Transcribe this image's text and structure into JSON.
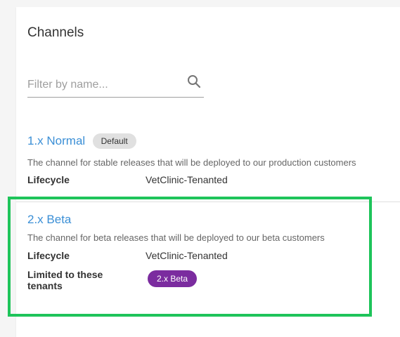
{
  "page": {
    "title": "Channels"
  },
  "filter": {
    "placeholder": "Filter by name...",
    "value": ""
  },
  "channels": [
    {
      "name": "1.x Normal",
      "badge": "Default",
      "description": "The channel for stable releases that will be deployed to our production customers",
      "lifecycle_label": "Lifecycle",
      "lifecycle_value": "VetClinic-Tenanted"
    },
    {
      "name": "2.x Beta",
      "description": "The channel for beta releases that will be deployed to our beta customers",
      "lifecycle_label": "Lifecycle",
      "lifecycle_value": "VetClinic-Tenanted",
      "tenants_label": "Limited to these tenants",
      "tenant_tags": [
        "2.x Beta"
      ]
    }
  ],
  "colors": {
    "link": "#3b8fd6",
    "tenant_tag": "#7b2c9f",
    "highlight": "#1ec45a",
    "badge_bg": "#e0e0e0"
  },
  "icons": {
    "search": "search-icon"
  }
}
